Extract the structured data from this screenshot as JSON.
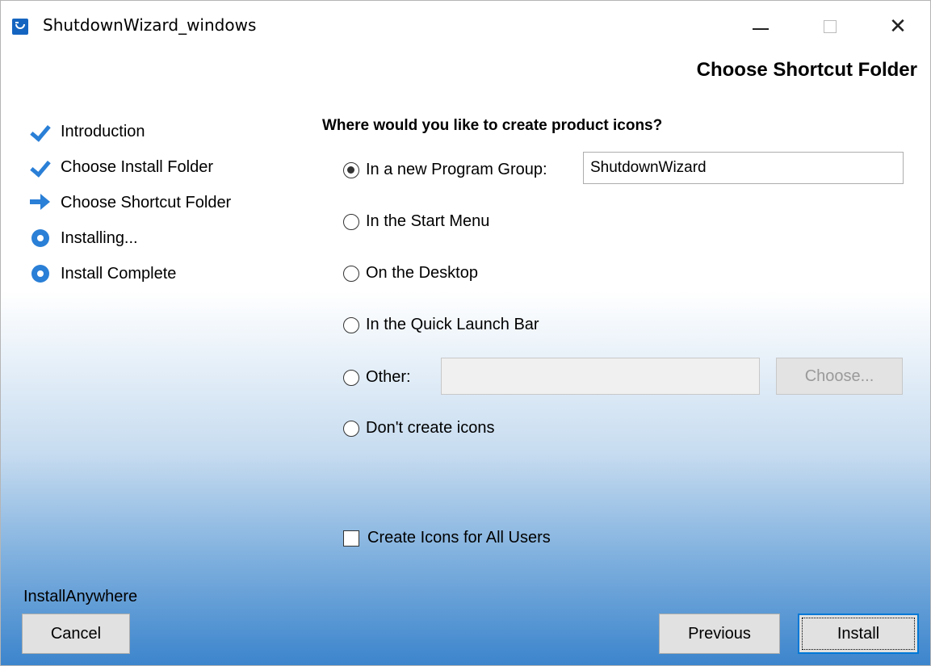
{
  "window": {
    "title": "ShutdownWizard_windows",
    "close_glyph": "✕"
  },
  "header": {
    "page_title": "Choose Shortcut Folder"
  },
  "steps": [
    {
      "label": "Introduction",
      "state": "done",
      "icon": "check-icon"
    },
    {
      "label": "Choose Install Folder",
      "state": "done",
      "icon": "check-icon"
    },
    {
      "label": "Choose Shortcut Folder",
      "state": "current",
      "icon": "arrow-right-icon"
    },
    {
      "label": "Installing...",
      "state": "pending",
      "icon": "ring-icon"
    },
    {
      "label": "Install Complete",
      "state": "pending",
      "icon": "ring-icon"
    }
  ],
  "main": {
    "question": "Where would you like to create product icons?",
    "options": [
      {
        "label": "In a new Program Group:",
        "checked": true
      },
      {
        "label": "In the Start Menu",
        "checked": false
      },
      {
        "label": "On the Desktop",
        "checked": false
      },
      {
        "label": "In the Quick Launch Bar",
        "checked": false
      },
      {
        "label": "Other:",
        "checked": false
      },
      {
        "label": "Don't create icons",
        "checked": false
      }
    ],
    "program_group_value": "ShutdownWizard",
    "other_value": "",
    "choose_label": "Choose...",
    "all_users_label": "Create Icons for All Users",
    "all_users_checked": false
  },
  "footer": {
    "brand": "InstallAnywhere",
    "cancel_label": "Cancel",
    "previous_label": "Previous",
    "install_label": "Install"
  }
}
